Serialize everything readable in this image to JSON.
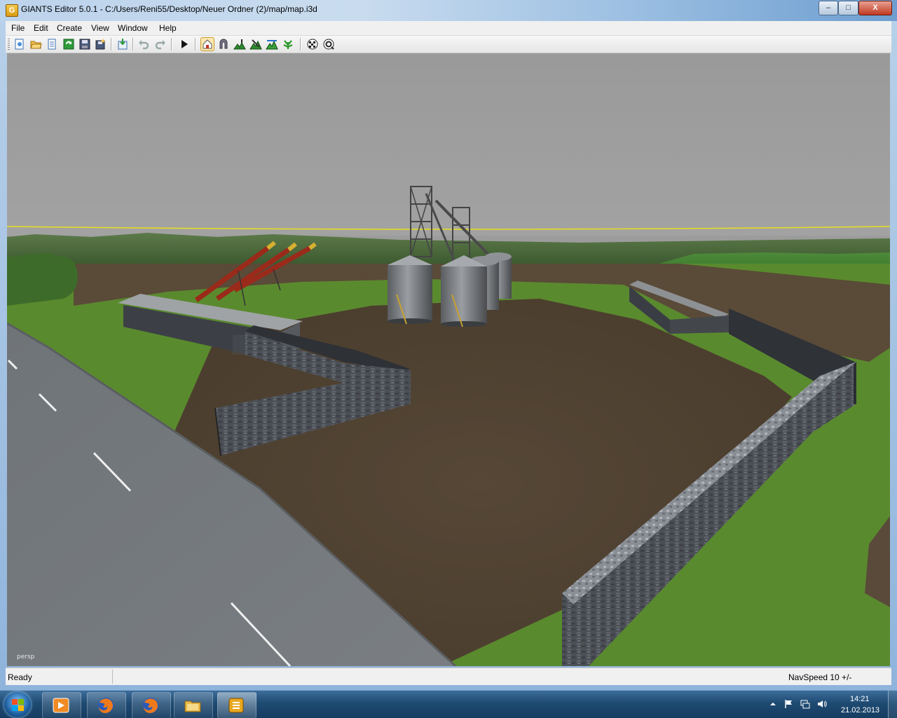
{
  "window": {
    "title": "GIANTS Editor 5.0.1 - C:/Users/Reni55/Desktop/Neuer Ordner (2)/map/map.i3d",
    "app_icon_letter": "G",
    "minimize_glyph": "–",
    "maximize_glyph": "□",
    "close_glyph": "X"
  },
  "menu": {
    "file": "File",
    "edit": "Edit",
    "create": "Create",
    "view": "View",
    "window": "Window",
    "help": "Help"
  },
  "toolbar_icons": [
    "new-icon",
    "open-icon",
    "properties-icon",
    "refresh-icon",
    "save-icon",
    "save-all-icon",
    "import-icon",
    "undo-icon",
    "redo-icon",
    "play-icon",
    "select-mode-icon",
    "move-mode-icon",
    "terrain-sculpt-icon",
    "terrain-paint-icon",
    "foliage-paint-icon",
    "checker-icon",
    "settings-icon"
  ],
  "viewport": {
    "camera_label": "persp",
    "sky_color": "#9c9c9c",
    "ground_color": "#4f4232",
    "grass_color": "#5a8a2e",
    "horizon_line_color": "#e8e020"
  },
  "status": {
    "text": "Ready",
    "navspeed": "NavSpeed 10 +/-"
  },
  "taskbar": {
    "apps": [
      "media-player-icon",
      "firefox-icon",
      "firefox-icon",
      "explorer-icon",
      "giants-editor-icon"
    ],
    "active_app": "giants-editor-icon",
    "tray_icons": [
      "show-hidden-icons-arrow",
      "action-center-flag-icon",
      "network-icon",
      "volume-icon"
    ],
    "time": "14:21",
    "date": "21.02.2013"
  }
}
